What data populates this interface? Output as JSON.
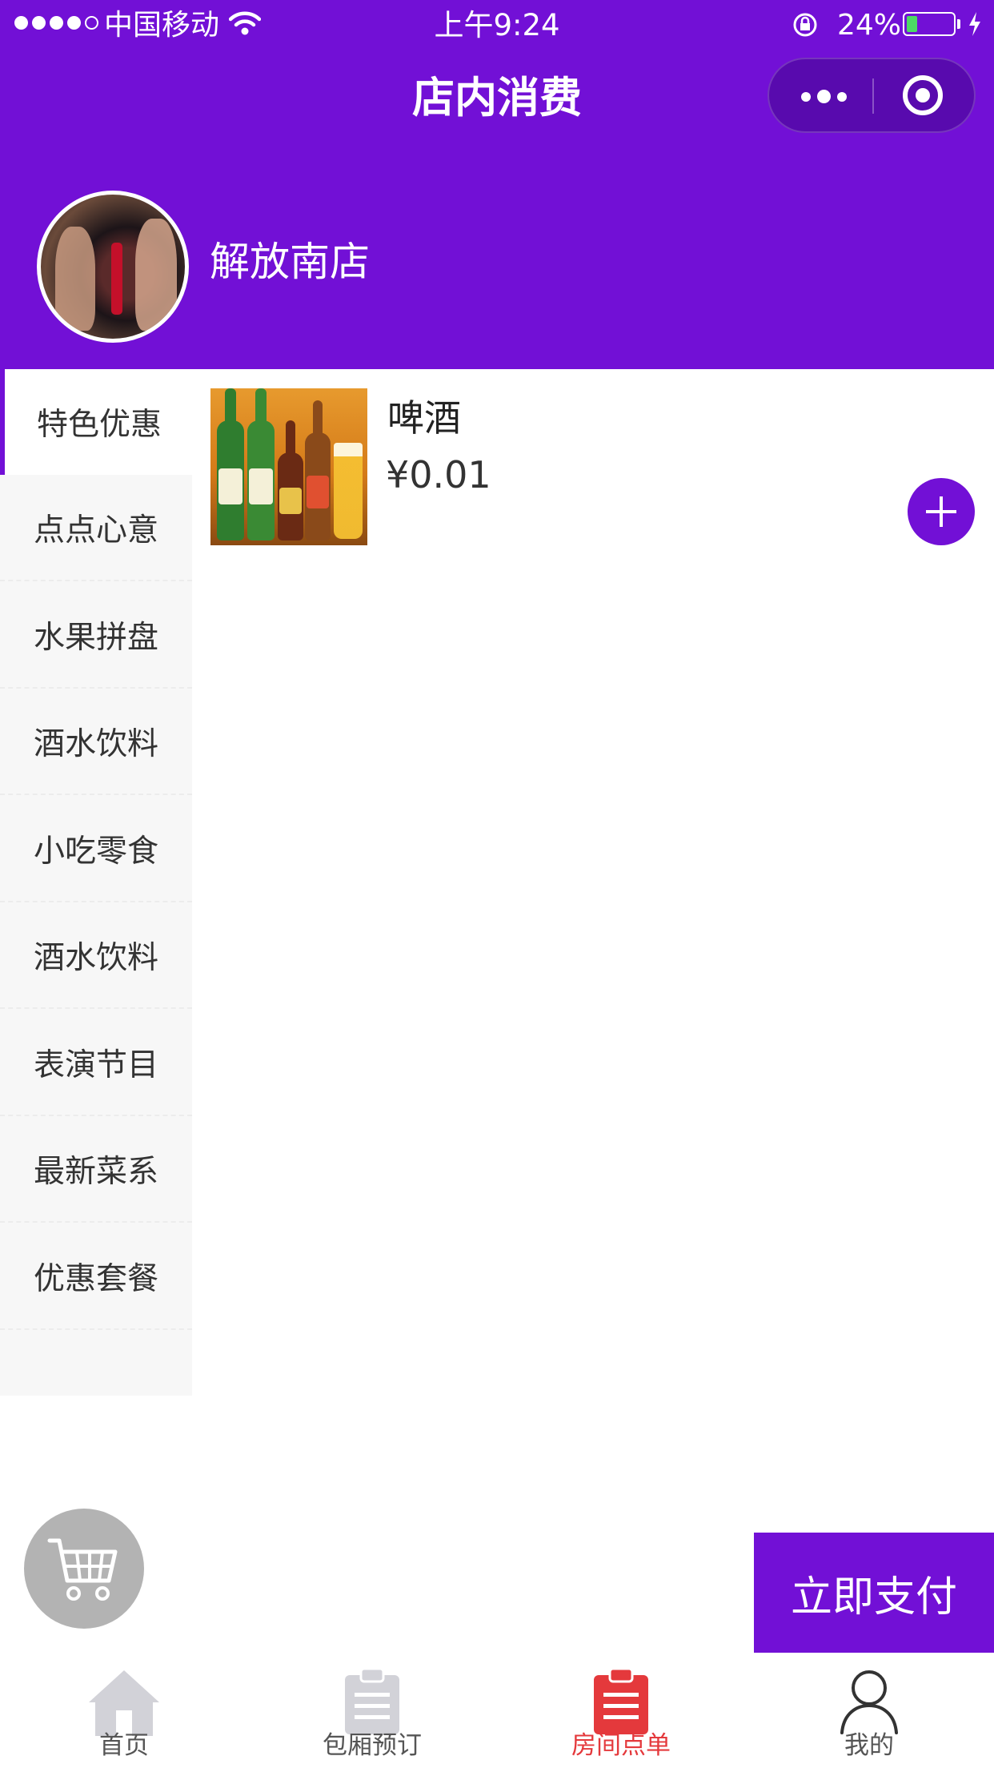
{
  "status_bar": {
    "carrier": "中国移动",
    "time": "上午9:24",
    "battery": "24%",
    "battery_level": 0.24
  },
  "header": {
    "title": "店内消费",
    "store_name": "解放南店"
  },
  "categories": [
    {
      "label": "特色优惠",
      "active": true
    },
    {
      "label": "点点心意"
    },
    {
      "label": "水果拼盘"
    },
    {
      "label": "酒水饮料"
    },
    {
      "label": "小吃零食"
    },
    {
      "label": "酒水饮料"
    },
    {
      "label": "表演节目"
    },
    {
      "label": "最新菜系"
    },
    {
      "label": "优惠套餐"
    }
  ],
  "products": [
    {
      "name": "啤酒",
      "price": "¥0.01"
    }
  ],
  "actions": {
    "pay_label": "立即支付"
  },
  "tabbar": [
    {
      "label": "首页",
      "icon": "home-icon"
    },
    {
      "label": "包厢预订",
      "icon": "clipboard-icon"
    },
    {
      "label": "房间点单",
      "icon": "clipboard-icon",
      "active": true
    },
    {
      "label": "我的",
      "icon": "user-icon"
    }
  ],
  "colors": {
    "brand_purple": "#7210d6",
    "active_tab_red": "#e4393c",
    "inactive_icon": "#d2d2d8"
  }
}
